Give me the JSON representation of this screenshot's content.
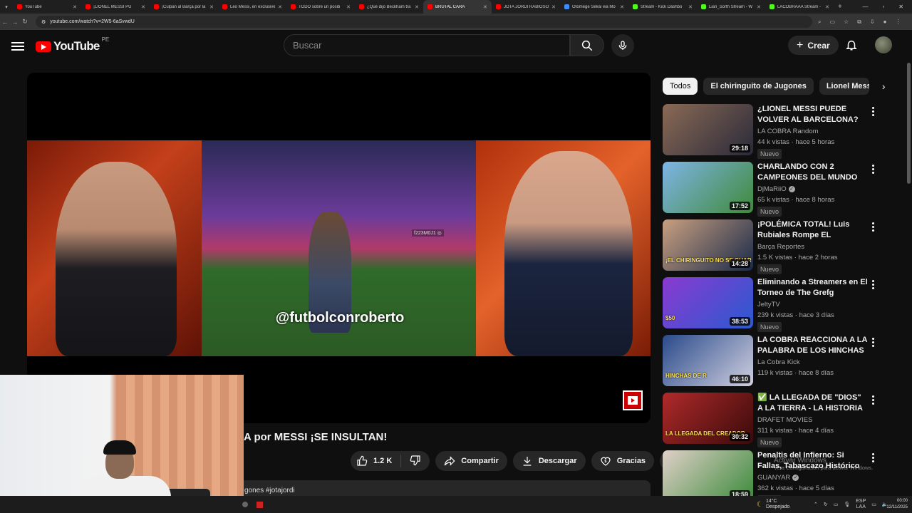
{
  "browser": {
    "tabs": [
      {
        "title": "YouTube",
        "color": "#ff0000",
        "active": false
      },
      {
        "title": "¡LIONEL MESSI PU",
        "color": "#ff0000",
        "active": false
      },
      {
        "title": "¡Culpan al Barça por la",
        "color": "#ff0000",
        "active": false
      },
      {
        "title": "Leo Messi, en exclusive",
        "color": "#ff0000",
        "active": false
      },
      {
        "title": "TODO sobre un posib",
        "color": "#ff0000",
        "active": false
      },
      {
        "title": "¿Qué dijo Beckham tra",
        "color": "#ff0000",
        "active": false
      },
      {
        "title": "BRUTAL CARA",
        "color": "#ff0000",
        "active": true
      },
      {
        "title": "JOTA JORDI RABIOSO",
        "color": "#ff0000",
        "active": false
      },
      {
        "title": "Otomege Sekai wa Mo",
        "color": "#3f8cff",
        "active": false
      },
      {
        "title": "Stream - Kick Dashbo",
        "color": "#53fc18",
        "active": false
      },
      {
        "title": "Lian_Sorth Stream - W",
        "color": "#53fc18",
        "active": false
      },
      {
        "title": "LACOBRAAA Stream -",
        "color": "#53fc18",
        "active": false
      }
    ],
    "url": "youtube.com/watch?v=2W5-6aSvwdU"
  },
  "masthead": {
    "logo_text": "YouTube",
    "country": "PE",
    "search_placeholder": "Buscar",
    "create_label": "Crear"
  },
  "video": {
    "overlay_handle": "@futbolconroberto",
    "corner_tag": "f223M0J1 ◎",
    "title": "A por MESSI ¡SE INSULTAN!",
    "likes": "1.2 K",
    "share_label": "Compartir",
    "download_label": "Descargar",
    "thanks_label": "Gracias",
    "description_snippet": "gones #jotajordi"
  },
  "chips": [
    "Todos",
    "El chiringuito de Jugones",
    "Lionel Mess"
  ],
  "recommendations": [
    {
      "title": "¿LIONEL MESSI PUEDE VOLVER AL BARCELONA? FUE AL CAM...",
      "channel": "LA COBRA Random",
      "verified": false,
      "meta": "44 k vistas · hace 5 horas",
      "badge": "Nuevo",
      "duration": "29:18",
      "thumb_text": "",
      "colors": [
        "#8a6a55",
        "#2a2a3a"
      ]
    },
    {
      "title": "CHARLANDO CON 2 CAMPEONES DEL MUNDO EN ...",
      "channel": "DjMaRiiO",
      "verified": true,
      "meta": "65 k vistas · hace 8 horas",
      "badge": "Nuevo",
      "duration": "17:52",
      "thumb_text": "",
      "colors": [
        "#7fb4e6",
        "#3f8a3a"
      ]
    },
    {
      "title": "¡POLÉMICA TOTAL! Luis Rubiales Rompe EL SILENCIO ...",
      "channel": "Barça Reportes",
      "verified": false,
      "meta": "1.5 K vistas · hace 2 horas",
      "badge": "Nuevo",
      "duration": "14:28",
      "thumb_text": "¡EL CHIRINGUITO NO SE GUAR",
      "colors": [
        "#c9a080",
        "#1a2a4a"
      ]
    },
    {
      "title": "Eliminando a Streamers en El Torneo de The Grefg",
      "channel": "JeltyTV",
      "verified": false,
      "meta": "239 k vistas · hace 3 días",
      "badge": "Nuevo",
      "duration": "38:53",
      "thumb_text": "$50",
      "colors": [
        "#8a3ad0",
        "#2a5ad0"
      ]
    },
    {
      "title": "LA COBRA REACCIONA A LA PALABRA DE LOS HINCHAS D...",
      "channel": "La Cobra Kick",
      "verified": false,
      "meta": "119 k vistas · hace 8 días",
      "badge": "",
      "duration": "46:10",
      "thumb_text": "HINCHAS DE R",
      "colors": [
        "#2a4a8a",
        "#d0d0e0"
      ]
    },
    {
      "title": "✅ LA LLEGADA DE \"DIOS\" A LA TIERRA - LA HISTORIA ...",
      "channel": "DRAFET MOVIES",
      "verified": false,
      "meta": "311 k vistas · hace 4 días",
      "badge": "Nuevo",
      "duration": "30:32",
      "thumb_text": "LA LLEGADA DEL CREADOR",
      "colors": [
        "#b02a2a",
        "#3a0a0a"
      ]
    },
    {
      "title": "Penaltis del Infierno: Si Fallas, Tabascazo Histórico",
      "channel": "GUANYAR",
      "verified": true,
      "meta": "362 k vistas · hace 5 días",
      "badge": "Nuevo",
      "duration": "18:59",
      "thumb_text": "",
      "colors": [
        "#e0d0c8",
        "#3a8a3a"
      ]
    }
  ],
  "windows": {
    "activate_title": "Activar Windows",
    "activate_sub": "Ve a Configuración para activar Windows.",
    "weather": "14°C",
    "weather_desc": "Despejado",
    "lang": "ESP",
    "lang_sub": "LAA",
    "time": "00:00",
    "date": "12/11/2025"
  }
}
